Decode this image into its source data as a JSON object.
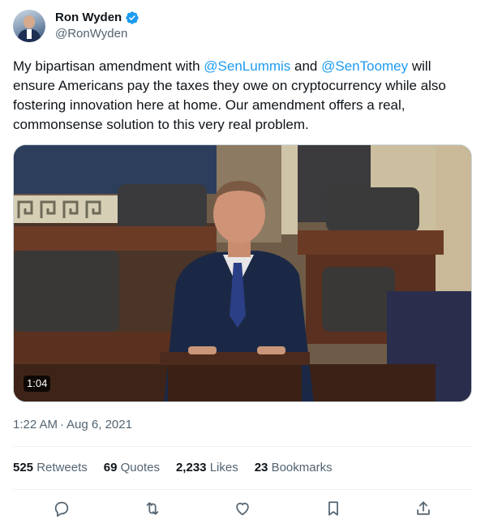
{
  "author": {
    "display_name": "Ron Wyden",
    "handle": "@RonWyden",
    "verified": true
  },
  "tweet": {
    "text_parts": [
      {
        "type": "text",
        "value": "My bipartisan amendment with "
      },
      {
        "type": "mention",
        "value": "@SenLummis"
      },
      {
        "type": "text",
        "value": " and "
      },
      {
        "type": "mention",
        "value": "@SenToomey"
      },
      {
        "type": "text",
        "value": " will ensure Americans pay the taxes they owe on cryptocurrency while also fostering innovation here at home. Our amendment offers a real, commonsense solution to this very real problem."
      }
    ]
  },
  "media": {
    "type": "video",
    "duration": "1:04"
  },
  "meta": {
    "time": "1:22 AM",
    "separator": "·",
    "date": "Aug 6, 2021"
  },
  "stats": {
    "retweets": {
      "count": "525",
      "label": "Retweets"
    },
    "quotes": {
      "count": "69",
      "label": "Quotes"
    },
    "likes": {
      "count": "2,233",
      "label": "Likes"
    },
    "bookmarks": {
      "count": "23",
      "label": "Bookmarks"
    }
  },
  "actions": [
    "reply-icon",
    "retweet-icon",
    "like-icon",
    "bookmark-icon",
    "share-icon"
  ],
  "colors": {
    "accent": "#1d9bf0",
    "secondary_text": "#536471",
    "primary_text": "#0f1419"
  }
}
